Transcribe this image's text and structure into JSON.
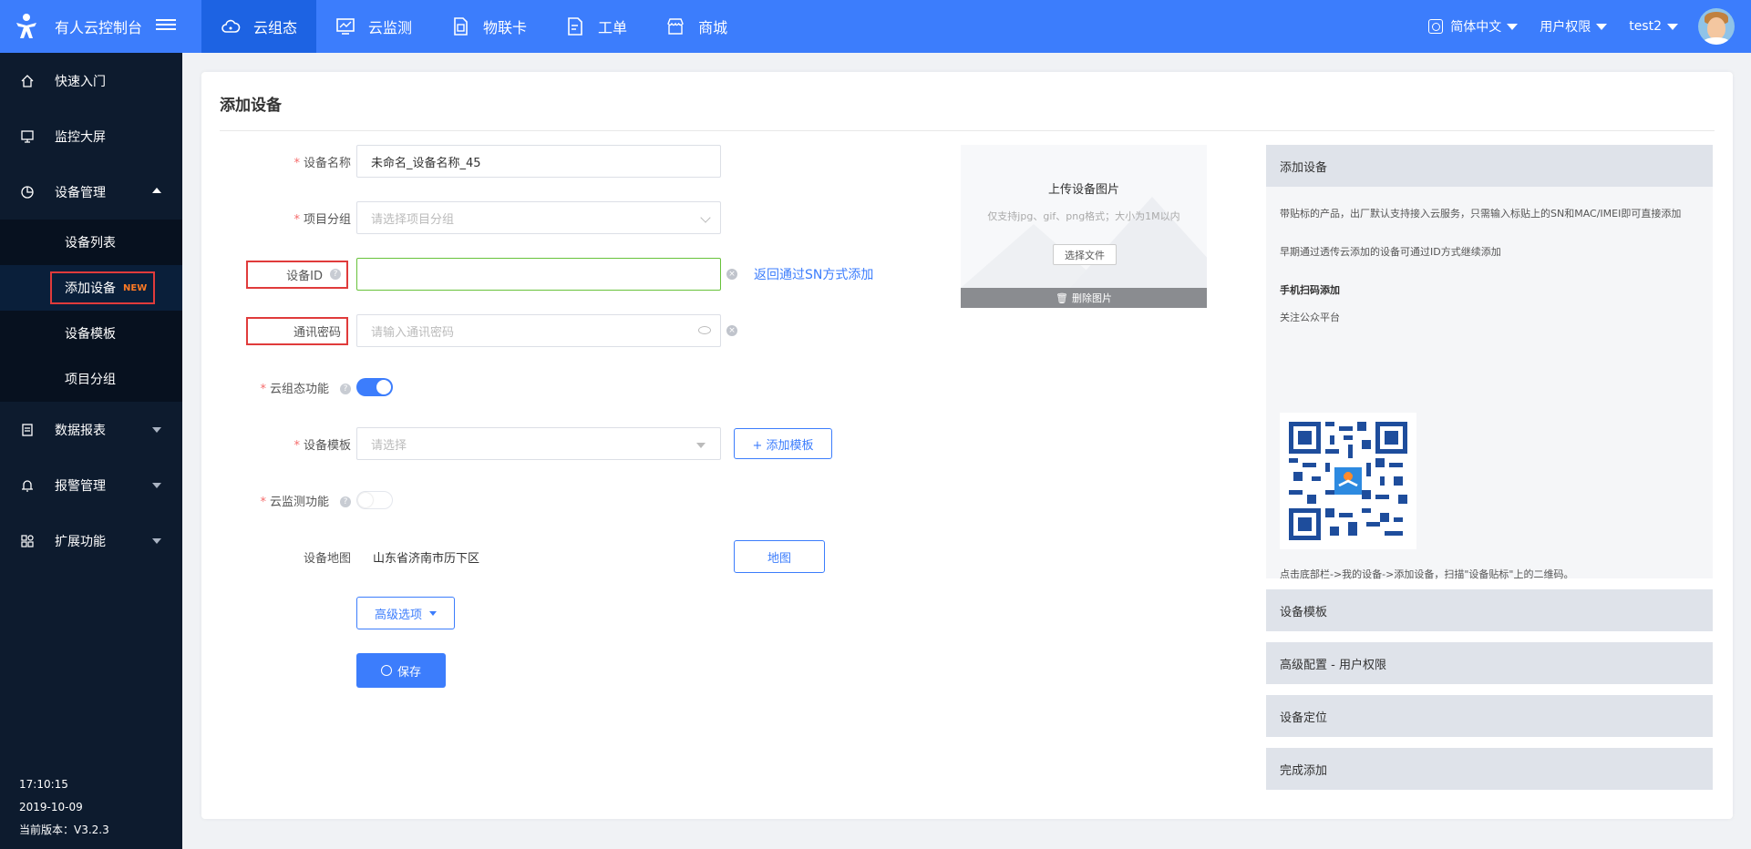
{
  "header": {
    "app_title": "有人云控制台",
    "nav": [
      {
        "label": "云组态",
        "icon": "cloud-icon",
        "active": true
      },
      {
        "label": "云监测",
        "icon": "monitor-icon",
        "active": false
      },
      {
        "label": "物联卡",
        "icon": "sim-card-icon",
        "active": false
      },
      {
        "label": "工单",
        "icon": "ticket-icon",
        "active": false
      },
      {
        "label": "商城",
        "icon": "store-icon",
        "active": false
      }
    ],
    "language": "简体中文",
    "permissions": "用户权限",
    "username": "test2"
  },
  "sidebar": {
    "items": [
      {
        "label": "快速入门",
        "icon": "home-icon"
      },
      {
        "label": "监控大屏",
        "icon": "screen-icon"
      },
      {
        "label": "设备管理",
        "icon": "device-icon"
      }
    ],
    "sub_items": [
      {
        "label": "设备列表"
      },
      {
        "label": "添加设备",
        "badge": "NEW"
      },
      {
        "label": "设备模板"
      },
      {
        "label": "项目分组"
      }
    ],
    "more_items": [
      {
        "label": "数据报表",
        "icon": "report-icon"
      },
      {
        "label": "报警管理",
        "icon": "alarm-icon"
      },
      {
        "label": "扩展功能",
        "icon": "extension-icon"
      }
    ],
    "time": "17:10:15",
    "date": "2019-10-09",
    "version": "当前版本：V3.2.3"
  },
  "page": {
    "title": "添加设备"
  },
  "form": {
    "device_name_label": "设备名称",
    "device_name_value": "未命名_设备名称_45",
    "project_group_label": "项目分组",
    "project_group_placeholder": "请选择项目分组",
    "device_id_label": "设备ID",
    "device_id_value": "",
    "sn_link": "返回通过SN方式添加",
    "password_label": "通讯密码",
    "password_placeholder": "请输入通讯密码",
    "cloud_config_label": "云组态功能",
    "cloud_config_on": true,
    "template_label": "设备模板",
    "template_placeholder": "请选择",
    "add_template_button": "+ 添加模板",
    "cloud_monitor_label": "云监测功能",
    "cloud_monitor_on": false,
    "map_label": "设备地图",
    "map_value": "山东省济南市历下区",
    "map_button": "地图",
    "advanced_button": "高级选项",
    "save_button": "保存"
  },
  "upload": {
    "title": "上传设备图片",
    "note": "仅支持jpg、gif、png格式；大小为1M以内",
    "choose_button": "选择文件",
    "delete_button": "删除图片"
  },
  "help_panel": {
    "section1_title": "添加设备",
    "para1": "带贴标的产品，出厂默认支持接入云服务，只需输入标贴上的SN和MAC/IMEI即可直接添加",
    "para2": "早期通过透传云添加的设备可通过ID方式继续添加",
    "scan_title": "手机扫码添加",
    "follow": "关注公众平台",
    "para3": "点击底部栏->我的设备->添加设备，扫描\"设备贴标\"上的二维码。",
    "sections": [
      "设备模板",
      "高级配置 - 用户权限",
      "设备定位",
      "完成添加"
    ]
  }
}
